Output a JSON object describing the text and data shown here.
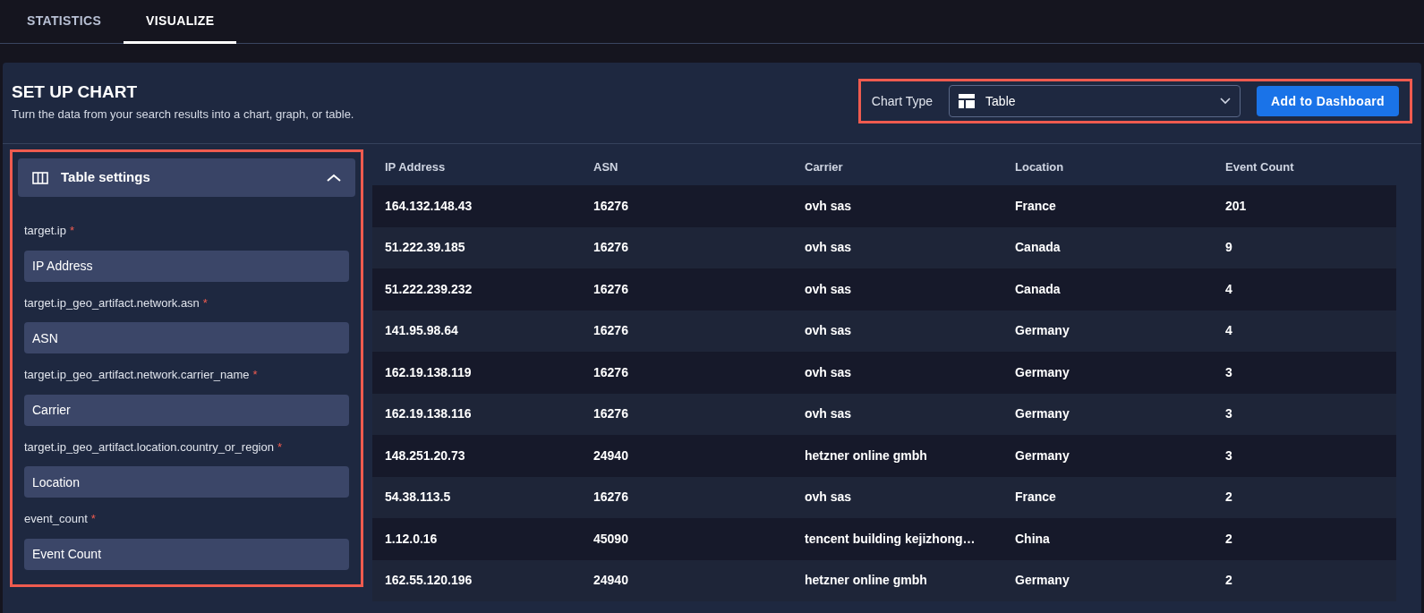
{
  "tabs": [
    {
      "label": "STATISTICS",
      "selected": false
    },
    {
      "label": "VISUALIZE",
      "selected": true
    }
  ],
  "header": {
    "title": "SET UP CHART",
    "subtitle": "Turn the data from your search results into a chart, graph, or table.",
    "chart_type_label": "Chart Type",
    "chart_type_value": "Table",
    "add_button": "Add to Dashboard"
  },
  "settings": {
    "title": "Table settings",
    "expanded": true,
    "fields": [
      {
        "label": "target.ip",
        "required_mark": "*",
        "value": "IP Address"
      },
      {
        "label": "target.ip_geo_artifact.network.asn",
        "required_mark": "*",
        "value": "ASN"
      },
      {
        "label": "target.ip_geo_artifact.network.carrier_name",
        "required_mark": "*",
        "value": "Carrier"
      },
      {
        "label": "target.ip_geo_artifact.location.country_or_region",
        "required_mark": "*",
        "value": "Location"
      },
      {
        "label": "event_count",
        "required_mark": "*",
        "value": "Event Count"
      }
    ]
  },
  "table": {
    "columns": [
      "IP Address",
      "ASN",
      "Carrier",
      "Location",
      "Event Count"
    ],
    "rows": [
      [
        "164.132.148.43",
        "16276",
        "ovh sas",
        "France",
        "201"
      ],
      [
        "51.222.39.185",
        "16276",
        "ovh sas",
        "Canada",
        "9"
      ],
      [
        "51.222.239.232",
        "16276",
        "ovh sas",
        "Canada",
        "4"
      ],
      [
        "141.95.98.64",
        "16276",
        "ovh sas",
        "Germany",
        "4"
      ],
      [
        "162.19.138.119",
        "16276",
        "ovh sas",
        "Germany",
        "3"
      ],
      [
        "162.19.138.116",
        "16276",
        "ovh sas",
        "Germany",
        "3"
      ],
      [
        "148.251.20.73",
        "24940",
        "hetzner online gmbh",
        "Germany",
        "3"
      ],
      [
        "54.38.113.5",
        "16276",
        "ovh sas",
        "France",
        "2"
      ],
      [
        "1.12.0.16",
        "45090",
        "tencent building kejizhong…",
        "China",
        "2"
      ],
      [
        "162.55.120.196",
        "24940",
        "hetzner online gmbh",
        "Germany",
        "2"
      ]
    ]
  }
}
